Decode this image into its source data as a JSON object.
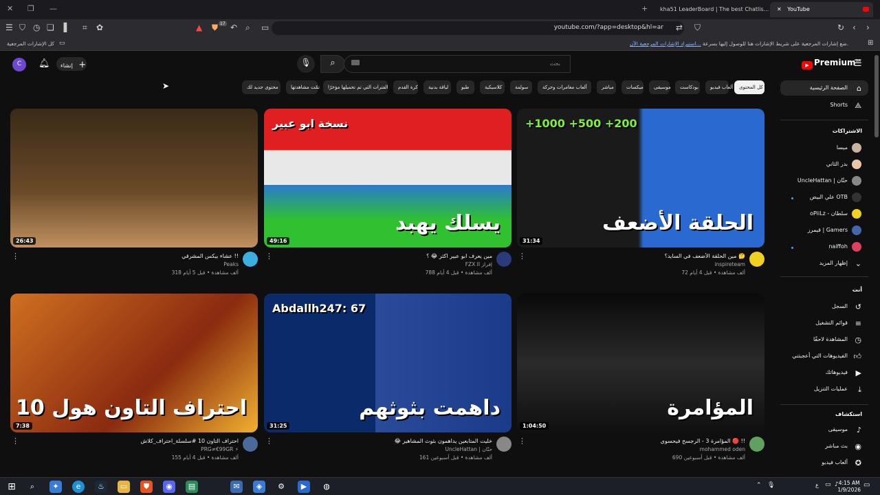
{
  "browser": {
    "tabs": [
      {
        "label": "kha51 LeaderBoard | The best Chatlis...",
        "active": false
      },
      {
        "label": "YouTube",
        "active": true
      }
    ],
    "url": "youtube.com/?app=desktop&hl=ar",
    "shield_badge": "17",
    "bookmarks_hint": "ضع إشارات المرجعية على شريط الإشارات هنا للوصول إليها بسرعة.",
    "bookmarks_import": "استيراد الإشارات المرجعية الآن...",
    "bookmarks_all": "كل الإشارات المرجعية"
  },
  "header": {
    "logo": "Premium",
    "logo_sup": "SA",
    "search_placeholder": "بحث",
    "create_label": "إنشاء",
    "avatar_letter": "C"
  },
  "chips": [
    {
      "label": "كل المحتوى",
      "selected": true
    },
    {
      "label": "ألعاب فيديو"
    },
    {
      "label": "بودكاست"
    },
    {
      "label": "موسيقى"
    },
    {
      "label": "ميكسات"
    },
    {
      "label": "مباشر"
    },
    {
      "label": "ألعاب مغامرات وحركة"
    },
    {
      "label": "سولمة"
    },
    {
      "label": "كلاسيكية"
    },
    {
      "label": "طبو"
    },
    {
      "label": "لياقة بدنية"
    },
    {
      "label": "كرة القدم"
    },
    {
      "label": "الفترات التي تم تحميلها مؤخرًا"
    },
    {
      "label": "تمّت مشاهدتها"
    },
    {
      "label": "محتوى جديد لك"
    }
  ],
  "sidebar": {
    "main": [
      {
        "label": "الصفحة الرئيسية",
        "icon": "home-icon",
        "selected": true
      },
      {
        "label": "Shorts",
        "icon": "shorts-icon"
      }
    ],
    "subs_header": "الاشتراكات",
    "subs": [
      {
        "label": "ميسا",
        "color": "#c8b4a0",
        "dot": false
      },
      {
        "label": "بدر الثاني",
        "color": "#e8c8a8",
        "dot": false
      },
      {
        "label": "UncleHattan | حتّان",
        "color": "#888888",
        "dot": false
      },
      {
        "label": "علي البيض OTB",
        "color": "#333333",
        "dot": true
      },
      {
        "label": "oPiiLz - سلطان",
        "color": "#f0d020",
        "dot": false
      },
      {
        "label": "قيمرز | Gamers",
        "color": "#4466aa",
        "dot": false
      },
      {
        "label": "naiffoh",
        "color": "#e04060",
        "dot": true
      }
    ],
    "show_more": "إظهار المزيد",
    "you_header": "أنت",
    "you": [
      {
        "label": "السجل",
        "icon": "history-icon"
      },
      {
        "label": "قوائم التشغيل",
        "icon": "playlist-icon"
      },
      {
        "label": "المشاهدة لاحقًا",
        "icon": "clock-icon"
      },
      {
        "label": "الفيديوهات التي أعجبتني",
        "icon": "like-icon"
      },
      {
        "label": "فيديوهاتك",
        "icon": "video-icon"
      },
      {
        "label": "عمليات التنزيل",
        "icon": "download-icon"
      }
    ],
    "explore_header": "استكشاف",
    "explore": [
      {
        "label": "موسيقى",
        "icon": "music-icon"
      },
      {
        "label": "بث مباشر",
        "icon": "live-icon"
      },
      {
        "label": "ألعاب فيديو",
        "icon": "gaming-icon"
      }
    ]
  },
  "videos": [
    {
      "title": "مين الحلقة الأضعف في السايد؟ 🤔",
      "channel": "inspireteam",
      "meta": "72 ألف مشاهدة • قبل 4 أيام",
      "duration": "31:34",
      "thumb_text_top": "+1000 +500 +200",
      "thumb_text": "الحلقة الأضعف",
      "thumb_color": "#1a1a1a",
      "avatar_color": "#f0d020"
    },
    {
      "title": "مين يعرف ابو عبير اكثر 😂 ؟",
      "channel": "FZX II إفراز",
      "meta": "788 ألف مشاهدة • قبل 4 أيام",
      "duration": "49:16",
      "thumb_text_top": "نسخة ابو عبير",
      "thumb_text": "يسلك يهبد",
      "thumb_color": "#3a3a3a",
      "avatar_color": "#2a3a7a"
    },
    {
      "title": "عشاء بيكس المشرقي !!",
      "channel": "Peaks",
      "meta": "318 ألف مشاهدة • قبل 5 أيام",
      "duration": "26:43",
      "thumb_text_top": "",
      "thumb_text": "",
      "thumb_color": "#5a3a1a",
      "avatar_color": "#3ab0e0"
    },
    {
      "title": "المؤامرة 3 - الرجسح فيحسوي 🔴 !!",
      "channel": "mohammed oden",
      "meta": "690 ألف مشاهدة • قبل أسبوعين",
      "duration": "1:04:50",
      "thumb_text_top": "",
      "thumb_text": "المؤامرة",
      "thumb_color": "#1a2a3a",
      "avatar_color": "#60a060"
    },
    {
      "title": "😂 خليت المتابعين يداهمون بثوث المشاهير",
      "channel": "UncleHattan | حتّان",
      "meta": "161 ألف مشاهدة • قبل أسبوعين",
      "duration": "31:25",
      "thumb_text_top": "Abdallh247: 67",
      "thumb_text": "داهمت بثوثهم",
      "thumb_color": "#1a3a6a",
      "avatar_color": "#888888"
    },
    {
      "title": "احتراف التاون 10 #سلسلة_احتراف_كلاش",
      "channel": "PRG≠€99GR ⚡",
      "meta": "155 ألف مشاهدة • قبل 4 أيام",
      "duration": "7:38",
      "thumb_text_top": "",
      "thumb_text": "احتراف التاون هول 10",
      "thumb_color": "#8a4a1a",
      "avatar_color": "#4a6a9a"
    }
  ],
  "taskbar": {
    "time": "4:15 AM",
    "date": "1/9/2026",
    "lang": "ع"
  }
}
